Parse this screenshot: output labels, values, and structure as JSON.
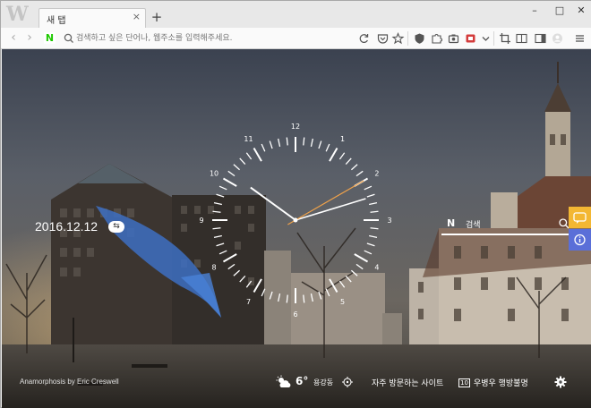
{
  "tab": {
    "title": "새 탭",
    "close": "×",
    "new_tab": "+"
  },
  "window_controls": {
    "minimize": "–",
    "maximize": "□",
    "close": "✕"
  },
  "nav": {
    "back": "‹",
    "forward": "›"
  },
  "address_bar": {
    "brand": "N",
    "placeholder": "검색하고 싶은 단어나, 웹주소를 입력해주세요."
  },
  "toolbar_icons": [
    "reload-icon",
    "pocket-icon",
    "star-icon",
    "shield-icon",
    "puzzle-icon",
    "camera-icon",
    "recorder-icon",
    "chevron-down-icon",
    "crop-icon",
    "reader-icon",
    "sidebar-icon",
    "avatar-icon",
    "menu-icon"
  ],
  "clock": {
    "numbers": [
      "12",
      "1",
      "2",
      "3",
      "4",
      "5",
      "6",
      "7",
      "8",
      "9",
      "10",
      "11"
    ],
    "hour": 10,
    "minute": 12,
    "second": 10
  },
  "date": "2016.12.12",
  "search": {
    "brand": "N",
    "label": "검색"
  },
  "credit": "Anamorphosis by Eric Creswell",
  "weather": {
    "temp": "6°",
    "location": "용강동"
  },
  "bottom_links": {
    "frequent": "자주 방문하는 사이트",
    "news": "우병우 행방불명",
    "news_rank": "10"
  },
  "colors": {
    "accent_orange": "#f0a24a",
    "yellow_button": "#f3b733",
    "blue_button": "#5a6fd8",
    "naver_green": "#1ec800"
  }
}
